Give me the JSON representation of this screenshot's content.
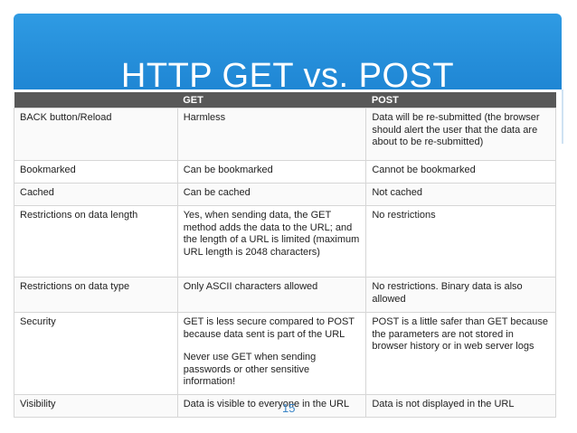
{
  "slide": {
    "title": "HTTP GET vs. POST",
    "page_number": "15"
  },
  "table": {
    "headers": [
      "",
      "GET",
      "POST"
    ],
    "rows": [
      {
        "label": "BACK button/Reload",
        "get": "Harmless",
        "post": "Data will be re-submitted (the browser should alert the user that the data are about to be re-submitted)"
      },
      {
        "label": "Bookmarked",
        "get": "Can be bookmarked",
        "post": "Cannot be bookmarked"
      },
      {
        "label": "Cached",
        "get": "Can be cached",
        "post": "Not cached"
      },
      {
        "label": "Restrictions on data length",
        "get": "Yes, when sending data, the GET method adds the data to the URL; and the length of a URL is limited (maximum URL length is 2048 characters)",
        "post": "No restrictions"
      },
      {
        "label": "Restrictions on data type",
        "get": "Only ASCII characters allowed",
        "post": "No restrictions. Binary data is also allowed"
      },
      {
        "label": "Security",
        "get": "GET is less secure compared to POST because data sent is part of the URL",
        "get_note": "Never use GET when sending passwords or other sensitive information!",
        "post": "POST is a little safer than GET because the parameters are not stored in browser history or in web server logs"
      },
      {
        "label": "Visibility",
        "get": "Data is visible to everyone in the URL",
        "post": "Data is not displayed in the URL"
      }
    ]
  },
  "colors": {
    "header_blue": "#1f86d4",
    "table_header": "#585858",
    "page_number": "#3b86c8"
  }
}
